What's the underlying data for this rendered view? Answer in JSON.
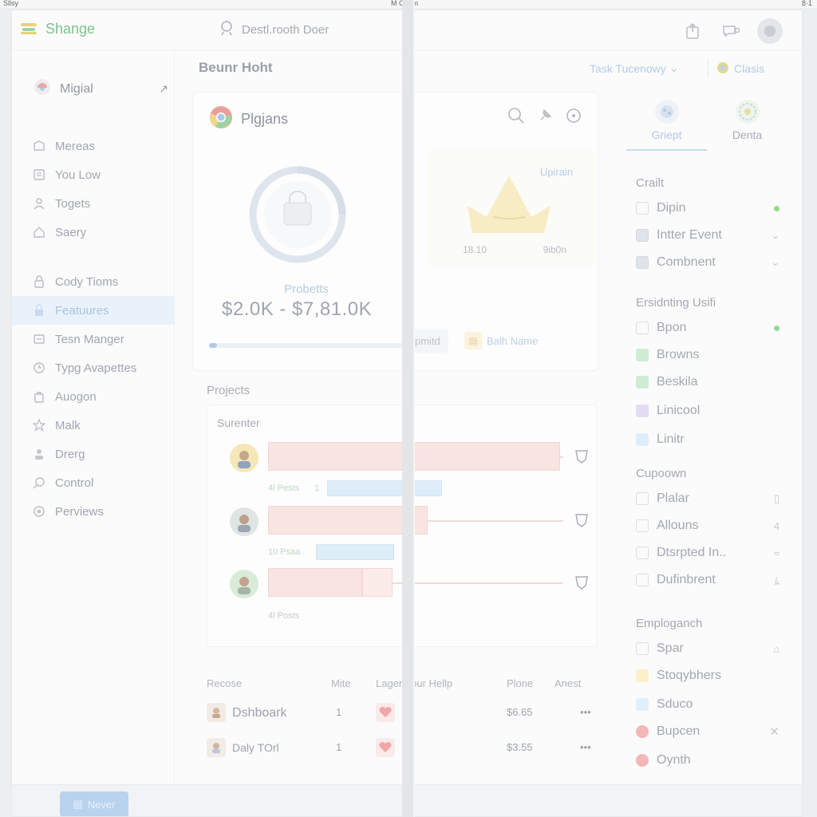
{
  "status": {
    "left": "Sllsy",
    "center": "M Chom",
    "right": "8·1"
  },
  "app": {
    "name": "Shange",
    "search_placeholder": "Destl.rooth Doer"
  },
  "sidebar": {
    "header": "Migial",
    "items": [
      {
        "label": "Mereas",
        "icon": "inbox-icon"
      },
      {
        "label": "You Low",
        "icon": "calendar-icon"
      },
      {
        "label": "Togets",
        "icon": "user-icon"
      },
      {
        "label": "Saery",
        "icon": "star-icon"
      },
      {
        "label": "Cody Tioms",
        "icon": "lock-icon"
      },
      {
        "label": "Featuures",
        "icon": "lock-icon",
        "active": true
      },
      {
        "label": "Tesn Manger",
        "icon": "mail-icon"
      },
      {
        "label": "Typg Avapettes",
        "icon": "clock-icon"
      },
      {
        "label": "Auogon",
        "icon": "bag-icon"
      },
      {
        "label": "Malk",
        "icon": "star-icon"
      },
      {
        "label": "Drerg",
        "icon": "person-icon"
      },
      {
        "label": "Control",
        "icon": "search-icon"
      },
      {
        "label": "Perviews",
        "icon": "target-icon"
      }
    ]
  },
  "bottom": {
    "nav_label": "Never"
  },
  "main": {
    "title": "Beunr Hoht",
    "task_toggle": "Task Tucenowy",
    "class_button": "Clasis",
    "plugins": {
      "title": "Plgjans",
      "donut_label": "Probetts",
      "range": "$2.0K - $7,81.0K",
      "progress": 0.04,
      "mini_title": "Upirain",
      "mini_ticks": [
        "18.10",
        "9ib0n"
      ],
      "chip_a": "pmitd",
      "chip_b": "Balh Name"
    },
    "projects": {
      "title": "Projects",
      "subtitle": "Surenter",
      "rows": [
        {
          "meta": "4l Pests",
          "meta_num": "1"
        },
        {
          "meta": "10 Psaa",
          "meta_num": ""
        },
        {
          "meta": "4l Posts",
          "meta_num": ""
        }
      ]
    },
    "table": {
      "headers": [
        "Recose",
        "Mite",
        "Lager Your Hellp",
        "Plone",
        "Anest"
      ],
      "rows": [
        {
          "name": "Dshboark",
          "count": "1",
          "price": "$6.65"
        },
        {
          "name": "Daly TOrl",
          "count": "1",
          "price": "$3.55"
        }
      ]
    }
  },
  "right": {
    "tabs": [
      "Griept",
      "Denta"
    ],
    "groups": [
      {
        "title": "Crailt",
        "items": [
          {
            "label": "Dipin",
            "kind": "box",
            "trail": "green"
          },
          {
            "label": "Intter Event",
            "kind": "square-gray",
            "trail": "⌄"
          },
          {
            "label": "Combnent",
            "kind": "square-gray",
            "trail": "⌄"
          }
        ]
      },
      {
        "title": "Ersidnting Usifi",
        "items": [
          {
            "label": "Bpon",
            "kind": "box",
            "trail": "green"
          },
          {
            "label": "Browns",
            "kind": "square-green",
            "trail": ""
          },
          {
            "label": "Beskila",
            "kind": "square-green",
            "trail": ""
          },
          {
            "label": "Linicool",
            "kind": "square-purple",
            "trail": ""
          },
          {
            "label": "Linitr",
            "kind": "square-blue",
            "trail": ""
          }
        ]
      },
      {
        "title": "Cupoown",
        "items": [
          {
            "label": "Plalar",
            "kind": "box",
            "trail": "▯"
          },
          {
            "label": "Allouns",
            "kind": "box",
            "trail": "4"
          },
          {
            "label": "Dtsrpted In..",
            "kind": "box",
            "trail": "≈"
          },
          {
            "label": "Dufinbrent",
            "kind": "box",
            "trail": "ﾑ"
          }
        ]
      },
      {
        "title": "Emploganch",
        "items": [
          {
            "label": "Spar",
            "kind": "box",
            "trail": "⌂"
          },
          {
            "label": "Stoqybhers",
            "kind": "square-yellow",
            "trail": ""
          },
          {
            "label": "Sduco",
            "kind": "square-lightblue",
            "trail": ""
          },
          {
            "label": "Bupcen",
            "kind": "dot-red",
            "trail": "✕"
          },
          {
            "label": "Oynth",
            "kind": "dot-red",
            "trail": ""
          }
        ]
      }
    ]
  },
  "colors": {
    "accent": "#b3cbe6",
    "brand": "#7fc08f",
    "bar": "#f8e4e1"
  }
}
